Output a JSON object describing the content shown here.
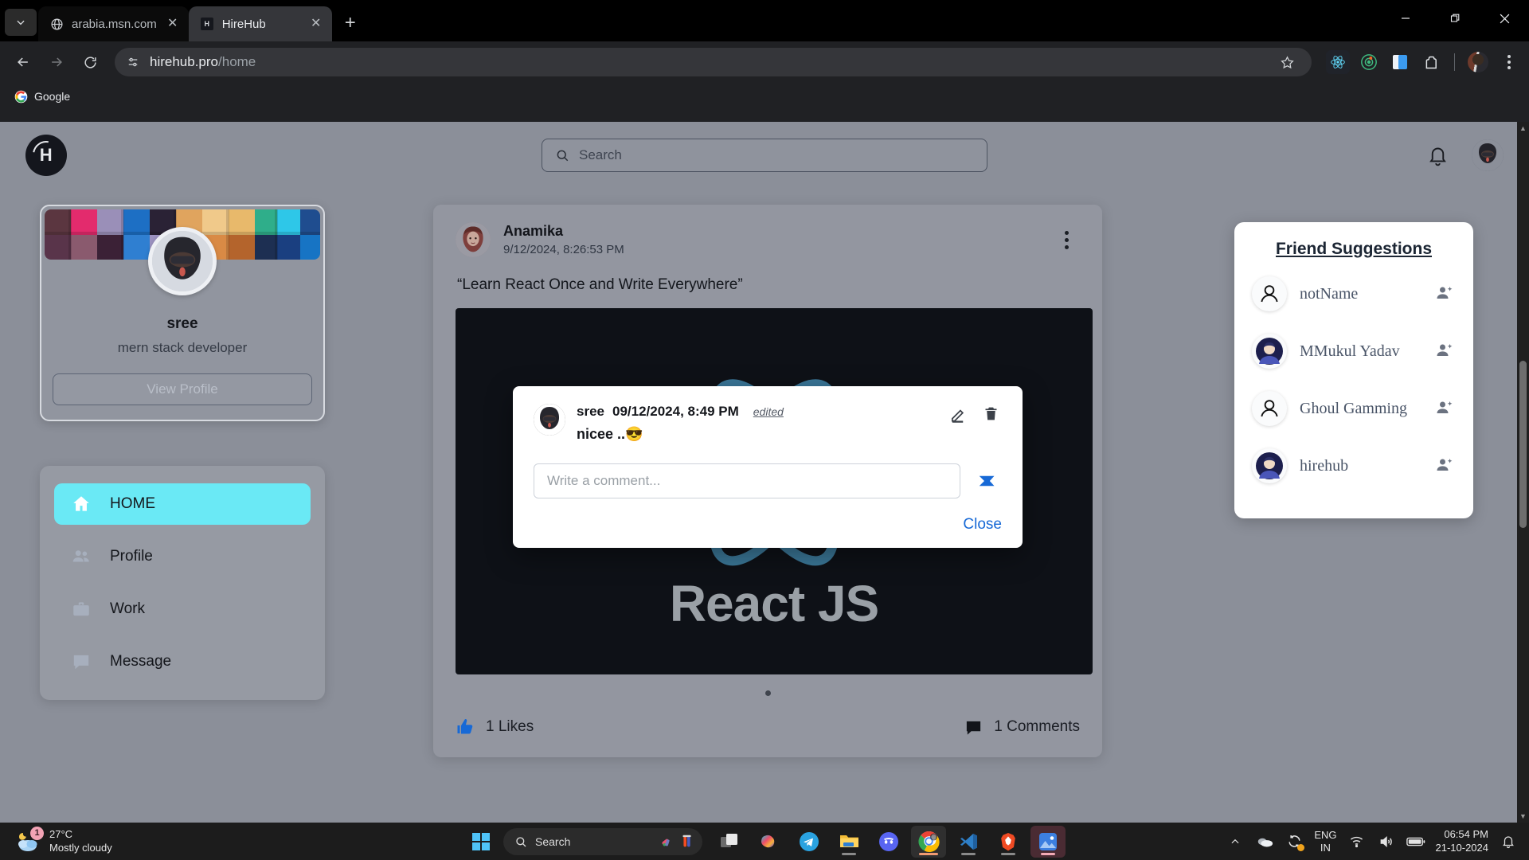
{
  "browser": {
    "tabs": [
      {
        "title": "arabia.msn.com",
        "favicon": "globe-icon",
        "active": false
      },
      {
        "title": "HireHub",
        "favicon": "hirehub-icon",
        "active": true
      }
    ],
    "new_tab_label": "+",
    "window_controls": {
      "minimize": "—",
      "maximize": "❐",
      "close": "✕"
    },
    "nav": {
      "back": "←",
      "forward": "→",
      "reload": "⟳"
    },
    "omnibox": {
      "host": "hirehub.pro",
      "path": "/home",
      "site_info_icon": "tune-icon",
      "star_icon": "bookmark-star-icon"
    },
    "extensions": [
      {
        "name": "react-devtools-icon"
      },
      {
        "name": "redux-devtools-icon"
      },
      {
        "name": "blue-extension-icon"
      },
      {
        "name": "puzzle-extensions-icon"
      },
      {
        "name": "browser-profile-avatar"
      }
    ],
    "menu_icon": "kebab-menu-icon",
    "bookmarks": [
      {
        "label": "Google",
        "icon": "google-icon"
      }
    ]
  },
  "app": {
    "logo_letter": "H",
    "search": {
      "placeholder": "Search",
      "icon": "search-icon"
    },
    "bell_icon": "notification-bell-icon",
    "avatar_icon": "user-avatar"
  },
  "profile": {
    "name": "sree",
    "title": "mern stack developer",
    "view_profile_label": "View Profile",
    "cover_alt": "color-cubes-cover"
  },
  "nav": {
    "items": [
      {
        "label": "HOME",
        "icon": "home-icon",
        "active": true
      },
      {
        "label": "Profile",
        "icon": "people-icon",
        "active": false
      },
      {
        "label": "Work",
        "icon": "briefcase-icon",
        "active": false
      },
      {
        "label": "Message",
        "icon": "chat-icon",
        "active": false
      }
    ]
  },
  "post": {
    "author": "Anamika",
    "timestamp": "9/12/2024, 8:26:53 PM",
    "text": "“Learn React Once and Write Everywhere”",
    "media_title": "React JS",
    "menu_icon": "more-vertical-icon",
    "likes_label": "1 Likes",
    "likes_icon": "thumbs-up-icon",
    "comments_label": "1 Comments",
    "comments_icon": "comment-icon"
  },
  "comment_modal": {
    "user": "sree",
    "timestamp": "09/12/2024, 8:49 PM",
    "edited_label": "edited",
    "text": "nicee ..😎",
    "edit_icon": "pencil-icon",
    "delete_icon": "trash-icon",
    "input_placeholder": "Write a comment...",
    "input_value": "",
    "send_icon": "send-icon",
    "close_label": "Close"
  },
  "friend_suggestions": {
    "title": "Friend Suggestions",
    "items": [
      {
        "name": "notName",
        "avatar": "default-user-avatar",
        "action_icon": "add-friend-icon"
      },
      {
        "name": "MMukul Yadav",
        "avatar": "user-photo-avatar",
        "action_icon": "add-friend-icon"
      },
      {
        "name": "Ghoul Gamming",
        "avatar": "default-user-avatar",
        "action_icon": "add-friend-icon"
      },
      {
        "name": "hirehub",
        "avatar": "user-photo-avatar",
        "action_icon": "add-friend-icon"
      }
    ]
  },
  "taskbar": {
    "weather": {
      "temperature": "27°C",
      "condition": "Mostly cloudy",
      "badge": "1",
      "icon": "moon-cloud-icon"
    },
    "start_icon": "windows-start-icon",
    "search": {
      "placeholder": "Search",
      "icon": "search-icon"
    },
    "apps": [
      {
        "name": "task-view-icon"
      },
      {
        "name": "copilot-icon"
      },
      {
        "name": "telegram-icon"
      },
      {
        "name": "file-explorer-icon"
      },
      {
        "name": "discord-icon"
      },
      {
        "name": "chrome-icon"
      },
      {
        "name": "vscode-icon"
      },
      {
        "name": "brave-icon"
      },
      {
        "name": "photos-icon"
      }
    ],
    "tray": {
      "chevron_icon": "show-hidden-icons-chevron",
      "onedrive_icon": "onedrive-icon",
      "update_icon": "windows-update-icon",
      "language": "ENG",
      "region": "IN",
      "wifi_icon": "wifi-icon",
      "volume_icon": "volume-icon",
      "battery_icon": "battery-icon",
      "time": "06:54 PM",
      "date": "21-10-2024",
      "notification_icon": "notification-bell-icon"
    }
  },
  "colors": {
    "accent_cyan": "#6ae9f5",
    "link_blue": "#1769d6",
    "page_bg": "#8b8f99",
    "media_bg": "#0e1117",
    "react_blue": "#61dafb"
  }
}
